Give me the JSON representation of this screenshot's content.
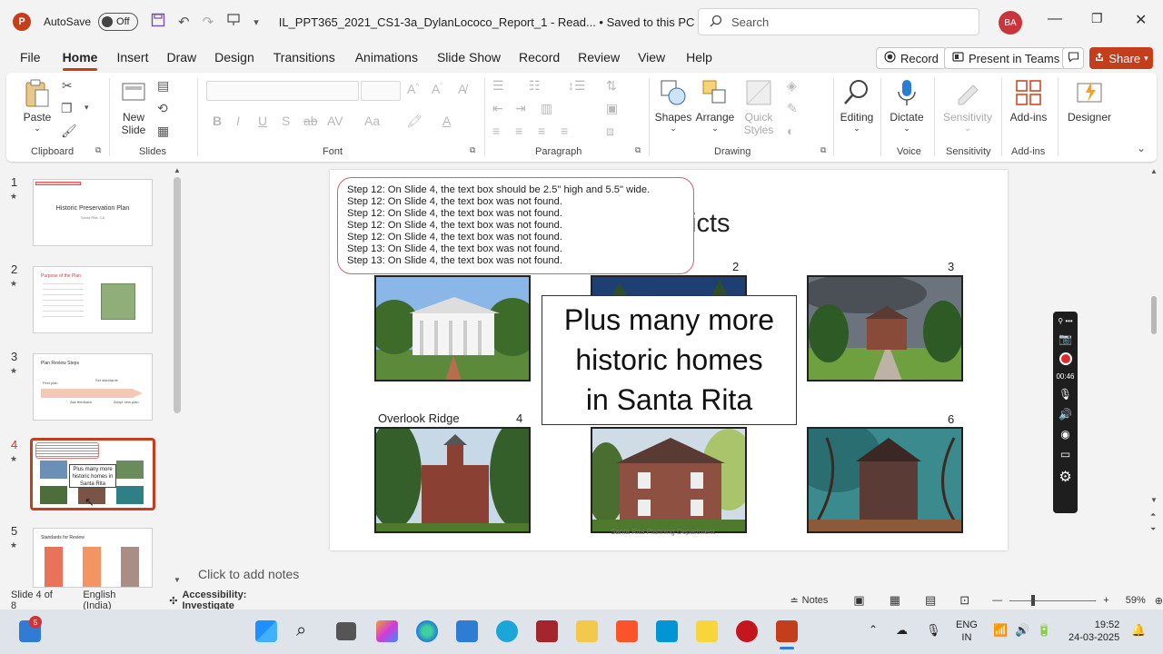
{
  "titlebar": {
    "app_logo": "P",
    "autosave_label": "AutoSave",
    "autosave_state": "Off",
    "doc_title": "IL_PPT365_2021_CS1-3a_DylanLococo_Report_1  -  Read...  •  Saved to this PC",
    "search_placeholder": "Search",
    "user_initials": "BA"
  },
  "menu": {
    "items": [
      "File",
      "Home",
      "Insert",
      "Draw",
      "Design",
      "Transitions",
      "Animations",
      "Slide Show",
      "Record",
      "Review",
      "View",
      "Help"
    ],
    "active": "Home",
    "record_label": "Record",
    "present_label": "Present in Teams",
    "share_label": "Share"
  },
  "ribbon": {
    "paste": "Paste",
    "new_slide_1": "New",
    "new_slide_2": "Slide",
    "shapes": "Shapes",
    "arrange": "Arrange",
    "quick_styles_1": "Quick",
    "quick_styles_2": "Styles",
    "editing": "Editing",
    "dictate": "Dictate",
    "sensitivity": "Sensitivity",
    "addins": "Add-ins",
    "designer": "Designer",
    "groups": {
      "clipboard": "Clipboard",
      "slides": "Slides",
      "font": "Font",
      "paragraph": "Paragraph",
      "drawing": "Drawing",
      "voice": "Voice",
      "sensitivity": "Sensitivity",
      "addins": "Add-ins"
    }
  },
  "thumbnails": [
    {
      "num": "1",
      "title": "Historic Preservation Plan",
      "sub": "Santa Rita, CA"
    },
    {
      "num": "2",
      "title": "Purpose of the Plan"
    },
    {
      "num": "3",
      "title": "Plan Review Steps",
      "steps": [
        "First plan",
        "Ask feedback",
        "Set standards",
        "Adopt new plan"
      ]
    },
    {
      "num": "4",
      "overlay": "Plus many more historic homes in Santa Rita"
    },
    {
      "num": "5",
      "title": "Standards for Review"
    }
  ],
  "slide": {
    "title_fragment": "icts",
    "overlay_text": [
      "Plus many more",
      "historic homes",
      "in Santa Rita"
    ],
    "photo_numbers": [
      "2",
      "3",
      "4",
      "6"
    ],
    "caption_4": "Overlook Ridge",
    "footer": "Santa Rita Planning Department",
    "log_lines": [
      "Step 12: On Slide 4, the text box should be 2.5\" high and 5.5\" wide.",
      "Step 12: On Slide 4, the text box was not found.",
      "Step 12: On Slide 4, the text box was not found.",
      "Step 12: On Slide 4, the text box was not found.",
      "Step 12: On Slide 4, the text box was not found.",
      "Step 13: On Slide 4, the text box was not found.",
      "Step 13: On Slide 4, the text box was not found."
    ],
    "notes_placeholder": "Click to add notes"
  },
  "recorder": {
    "time": "00:46"
  },
  "status": {
    "slide_count": "Slide 4 of 8",
    "language": "English (India)",
    "accessibility": "Accessibility: Investigate",
    "notes": "Notes",
    "zoom": "59%"
  },
  "taskbar": {
    "badge": "5",
    "lang_1": "ENG",
    "lang_2": "IN",
    "time": "19:52",
    "date": "24-03-2025"
  },
  "colors": {
    "accent": "#c43e1c",
    "taskbar": "#dfe4ea"
  }
}
